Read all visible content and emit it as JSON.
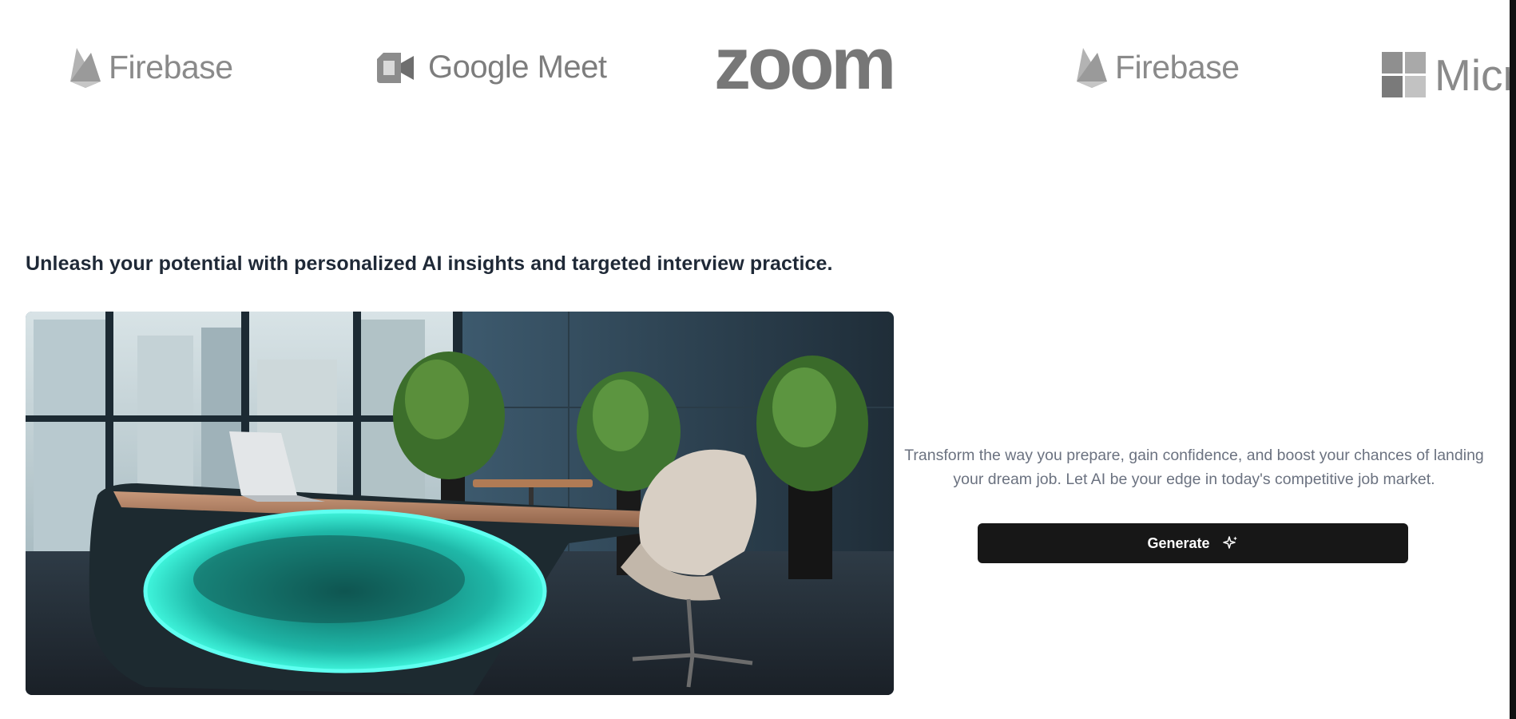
{
  "logos": [
    {
      "name": "Firebase",
      "icon": "firebase-flame-icon"
    },
    {
      "name": "Google Meet",
      "icon": "google-meet-camera-icon"
    },
    {
      "name": "zoom",
      "icon": "zoom-wordmark"
    },
    {
      "name": "Firebase",
      "icon": "firebase-flame-icon"
    },
    {
      "name": "Micro",
      "icon": "microsoft-windows-icon"
    }
  ],
  "tagline": "Unleash your potential with personalized AI insights and targeted interview practice.",
  "hero_image": {
    "alt": "",
    "icon": "office-desk-illustration"
  },
  "description": "Transform the way you prepare, gain confidence, and boost your chances of landing your dream job. Let AI be your edge in today's competitive job market.",
  "generate_button": {
    "label": "Generate",
    "icon": "sparkle-icon"
  },
  "colors": {
    "button_bg": "#171717",
    "logo_gray": "#8a8a8a",
    "glow": "#3ff5dc"
  }
}
